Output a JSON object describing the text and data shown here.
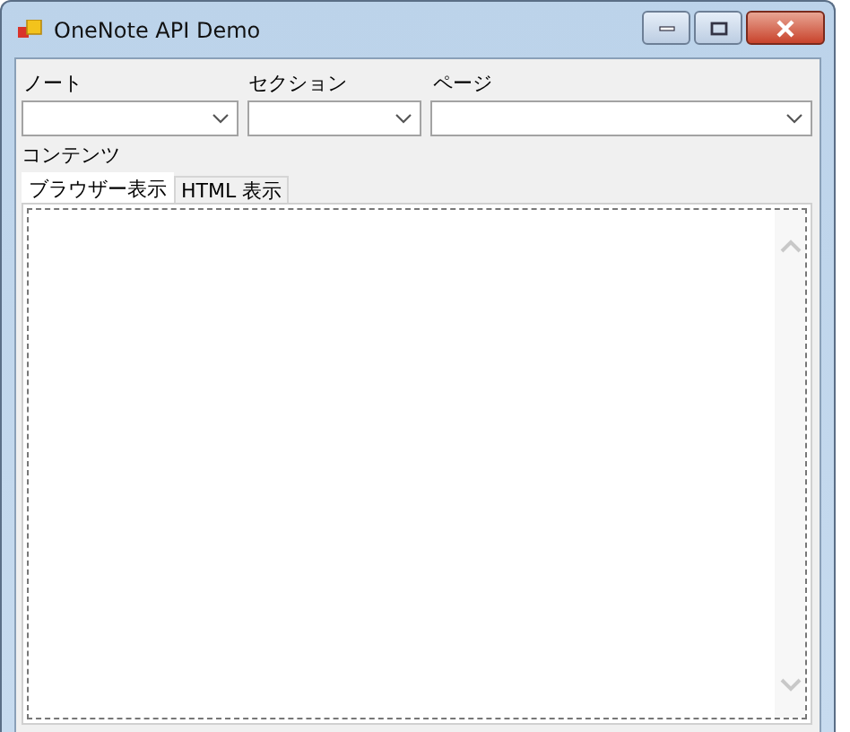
{
  "window": {
    "title": "OneNote API Demo"
  },
  "selectors": [
    {
      "label": "ノート"
    },
    {
      "label": "セクション"
    },
    {
      "label": "ページ"
    }
  ],
  "content_label": "コンテンツ",
  "tabs": [
    {
      "label": "ブラウザー表示",
      "selected": true
    },
    {
      "label": "HTML 表示",
      "selected": false
    }
  ]
}
